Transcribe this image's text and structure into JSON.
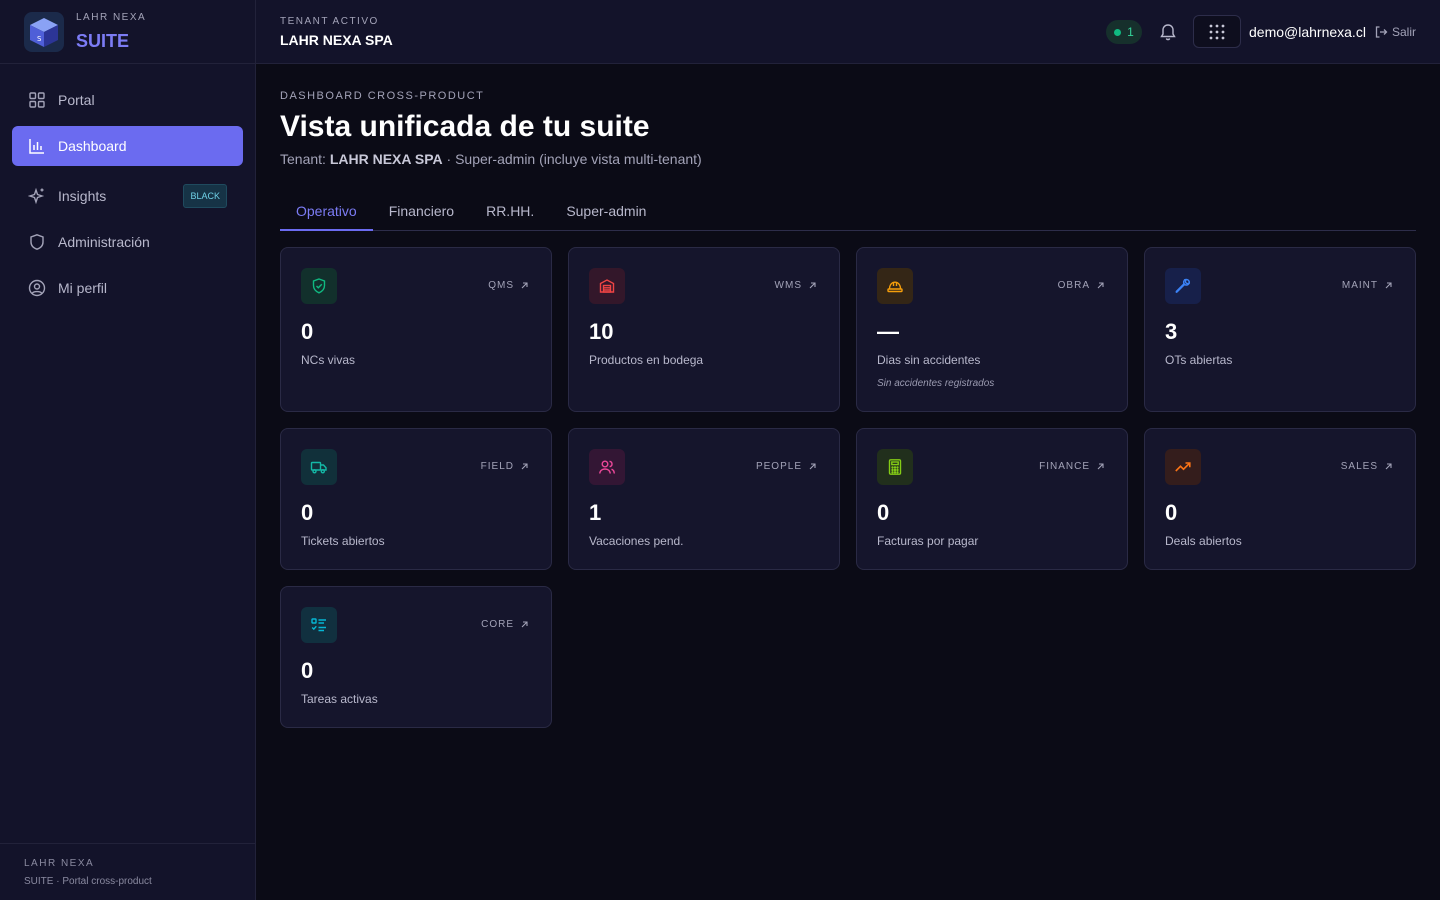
{
  "brand": {
    "small": "LAHR NEXA",
    "big": "SUITE"
  },
  "sidebar": {
    "items": [
      {
        "label": "Portal",
        "icon": "grid-icon"
      },
      {
        "label": "Dashboard",
        "icon": "bar-chart-icon",
        "active": true
      },
      {
        "label": "Insights",
        "icon": "sparkles-icon",
        "badge": "BLACK"
      },
      {
        "label": "Administración",
        "icon": "shield-icon"
      },
      {
        "label": "Mi perfil",
        "icon": "user-circle-icon"
      }
    ],
    "footer": {
      "line1": "LAHR NEXA",
      "line2": "SUITE · Portal cross-product"
    }
  },
  "topbar": {
    "tenant_label": "TENANT ACTIVO",
    "tenant_value": "LAHR NEXA SPA",
    "status_count": "1",
    "user_email": "demo@lahrnexa.cl",
    "logout_label": "Salir"
  },
  "main": {
    "kicker": "DASHBOARD CROSS-PRODUCT",
    "title": "Vista unificada de tu suite",
    "subtitle_prefix": "Tenant: ",
    "subtitle_tenant": "LAHR NEXA SPA",
    "subtitle_suffix": " · Super-admin (incluye vista multi-tenant)",
    "tabs": [
      "Operativo",
      "Financiero",
      "RR.HH.",
      "Super-admin"
    ],
    "active_tab": "Operativo"
  },
  "cards": [
    {
      "module": "QMS",
      "value": "0",
      "label": "NCs vivas",
      "icon": "shield-check-icon",
      "color": "#10b981",
      "bg": "#12302c"
    },
    {
      "module": "WMS",
      "value": "10",
      "label": "Productos en bodega",
      "icon": "warehouse-icon",
      "color": "#ef4444",
      "bg": "#33172a"
    },
    {
      "module": "OBRA",
      "value": "—",
      "label": "Dias sin accidentes",
      "note": "Sin accidentes registrados",
      "icon": "hard-hat-icon",
      "color": "#f59e0b",
      "bg": "#342616"
    },
    {
      "module": "MAINT",
      "value": "3",
      "label": "OTs abiertas",
      "icon": "wrench-icon",
      "color": "#3b82f6",
      "bg": "#17204a"
    },
    {
      "module": "FIELD",
      "value": "0",
      "label": "Tickets abiertos",
      "icon": "truck-icon",
      "color": "#14b8a6",
      "bg": "#11303a"
    },
    {
      "module": "PEOPLE",
      "value": "1",
      "label": "Vacaciones pend.",
      "icon": "users-icon",
      "color": "#ec4899",
      "bg": "#331634"
    },
    {
      "module": "FINANCE",
      "value": "0",
      "label": "Facturas por pagar",
      "icon": "calculator-icon",
      "color": "#84cc16",
      "bg": "#212f1c"
    },
    {
      "module": "SALES",
      "value": "0",
      "label": "Deals abiertos",
      "icon": "trending-up-icon",
      "color": "#f97316",
      "bg": "#341d1c"
    },
    {
      "module": "CORE",
      "value": "0",
      "label": "Tareas activas",
      "icon": "list-checks-icon",
      "color": "#06b6d4",
      "bg": "#11303f"
    }
  ]
}
